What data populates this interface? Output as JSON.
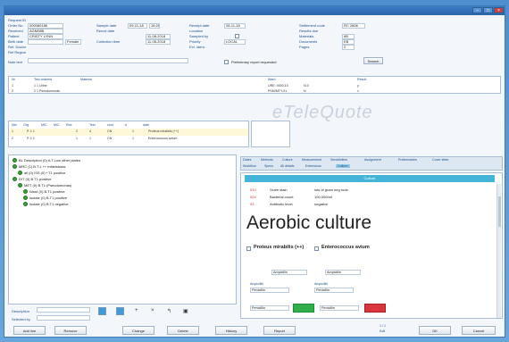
{
  "titlebar": {
    "title": ""
  },
  "header_fields": {
    "labels": [
      "Request ID",
      "Order No",
      "Received",
      "Patient",
      "Birth date",
      "Ref. Doctor",
      "Ref Region"
    ],
    "request_id": "000080186",
    "order_no": "AGM08B",
    "patient": "CRISTY LYNN",
    "birth_date": "",
    "sex_label": "Female",
    "date1": "09-11-18",
    "time1": "16:26",
    "date2": "11-08-2018",
    "labels_mid": [
      "Sample date",
      "Recvd date",
      "Collection time"
    ],
    "labels_right": [
      "Receipt date",
      "Location",
      "Sampled by",
      "Priority",
      "Ext. ident."
    ],
    "date3": "28-11-18",
    "loc": "LOCAL",
    "labels_far": [
      "Settlement code",
      "Results due",
      "Materials",
      "Documents",
      "Pages"
    ],
    "code": "RC 2806",
    "ward": "6B",
    "doc": "EB",
    "pages": "2",
    "note_label": "Note text",
    "checkbox_label": "Preliminary report requested",
    "rightbtn": "Search"
  },
  "grid1": {
    "headers": [
      "Nr",
      "Test ordered",
      "Material",
      "Ward",
      "Result"
    ],
    "rows": [
      [
        "1",
        "1  1  Urine",
        "URE: 0000-10",
        "N-0",
        "y"
      ],
      [
        "2",
        "2  1  Pseudomonas",
        "PSM/MTY-01",
        "N",
        "x"
      ]
    ]
  },
  "watermark": "eTeleQuote",
  "grid2": {
    "headers": [
      "Nbr",
      "Org",
      "MIC",
      "MIC",
      "Res",
      "Test",
      "cont",
      "#",
      "date"
    ],
    "rows": [
      [
        "1",
        "P.  1  1",
        "2",
        "4",
        "CN",
        "1",
        "Proteus mirabilis (++)"
      ],
      [
        "2",
        "P.  1  1",
        "1",
        "1",
        "CN",
        "1",
        "Enterococcus avium"
      ]
    ]
  },
  "tree": {
    "items": [
      "BL Description (0) A.T.Low other plates",
      "MRC (1) B.T.1 ++ mittelstrass",
      "all (0) ISS (0) +T1 positive",
      "DIT (0) B.T1 positive",
      "MET (0) B.T1 (Pseudomonas)",
      "Ward (0) B.T1 positive",
      "Isolate (0) B.T1 positive",
      "Isolate (0) B.T1 negative"
    ]
  },
  "bottom_left": {
    "label1": "Description",
    "label2": "Selected by",
    "icons": [
      "search-icon",
      "list-icon",
      "cross-icon",
      "x-icon",
      "arrow-icon",
      "save-icon"
    ]
  },
  "right_tabs": {
    "row1": [
      "Dates",
      "Methods",
      "Culture",
      "Measurement",
      "Sensitivities",
      "Assignment",
      "Preliminaries",
      "Cover letter"
    ],
    "row2": [
      "Workflow",
      "Specs",
      "All details",
      "Extensions",
      "Culture"
    ],
    "header": "Culture",
    "lines": [
      {
        "code": "010",
        "desc": "Gram stain",
        "value": "lots of gram neg rods"
      },
      {
        "code": "024",
        "desc": "Bacterial count",
        "value": "100,000/ml"
      },
      {
        "code": "03",
        "desc": "Antibiotic level",
        "value": "negative"
      }
    ],
    "big_title": "Aerobic culture",
    "org1": "Proteus mirabilis (++)",
    "org2": "Enterococcus avium",
    "small1": "Ampicillin",
    "small2": "Ampicillin",
    "lbl3": "Ampicillin",
    "lbl4": "Ampicillin",
    "val3": "Penicillin",
    "val4": "Penicillin",
    "family1": "Penicillin",
    "family2": "Penicillin"
  },
  "footer": {
    "buttons": [
      "Add line",
      "Remove",
      "Change",
      "Delete",
      "History",
      "Report"
    ],
    "meta_top": "1 / 1",
    "meta_bottom": "Edit",
    "ok": "OK",
    "cancel": "Cancel"
  },
  "colors": {
    "green": "#2fae4a",
    "red": "#d9363e",
    "cyan": "#44b4d8",
    "blue_btn": "#3f9ad8"
  }
}
